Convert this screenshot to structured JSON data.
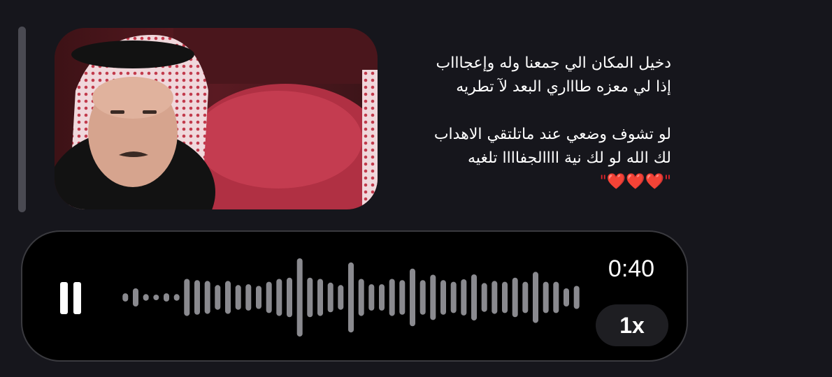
{
  "poem": {
    "lines": [
      "دخيل المكان الي جمعنا وله وإعجاااب",
      "إذا لي معزه طاااري البعد لآ تطريه",
      "لو تشوف وضعي عند ماتلتقي الاهداب",
      "لك الله لو لك  نية اااالجفاااا تلغيه"
    ],
    "hearts_line": "\"❤️❤️❤️\""
  },
  "voice_message": {
    "duration": "0:40",
    "speed": "1x",
    "state": "playing",
    "pause_icon": "pause-icon",
    "waveform_amplitudes": [
      0.1,
      0.22,
      0.08,
      0.05,
      0.1,
      0.08,
      0.45,
      0.42,
      0.4,
      0.3,
      0.4,
      0.3,
      0.32,
      0.28,
      0.38,
      0.45,
      0.48,
      0.95,
      0.48,
      0.45,
      0.36,
      0.3,
      0.85,
      0.45,
      0.32,
      0.32,
      0.45,
      0.42,
      0.7,
      0.42,
      0.55,
      0.42,
      0.38,
      0.44,
      0.56,
      0.35,
      0.4,
      0.38,
      0.48,
      0.38,
      0.62,
      0.38,
      0.38,
      0.22,
      0.28
    ]
  },
  "colors": {
    "background": "#16161c",
    "player_background": "#000000",
    "waveform": "#8a8a8f",
    "text": "#ffffff",
    "heart": "#e3242b"
  }
}
